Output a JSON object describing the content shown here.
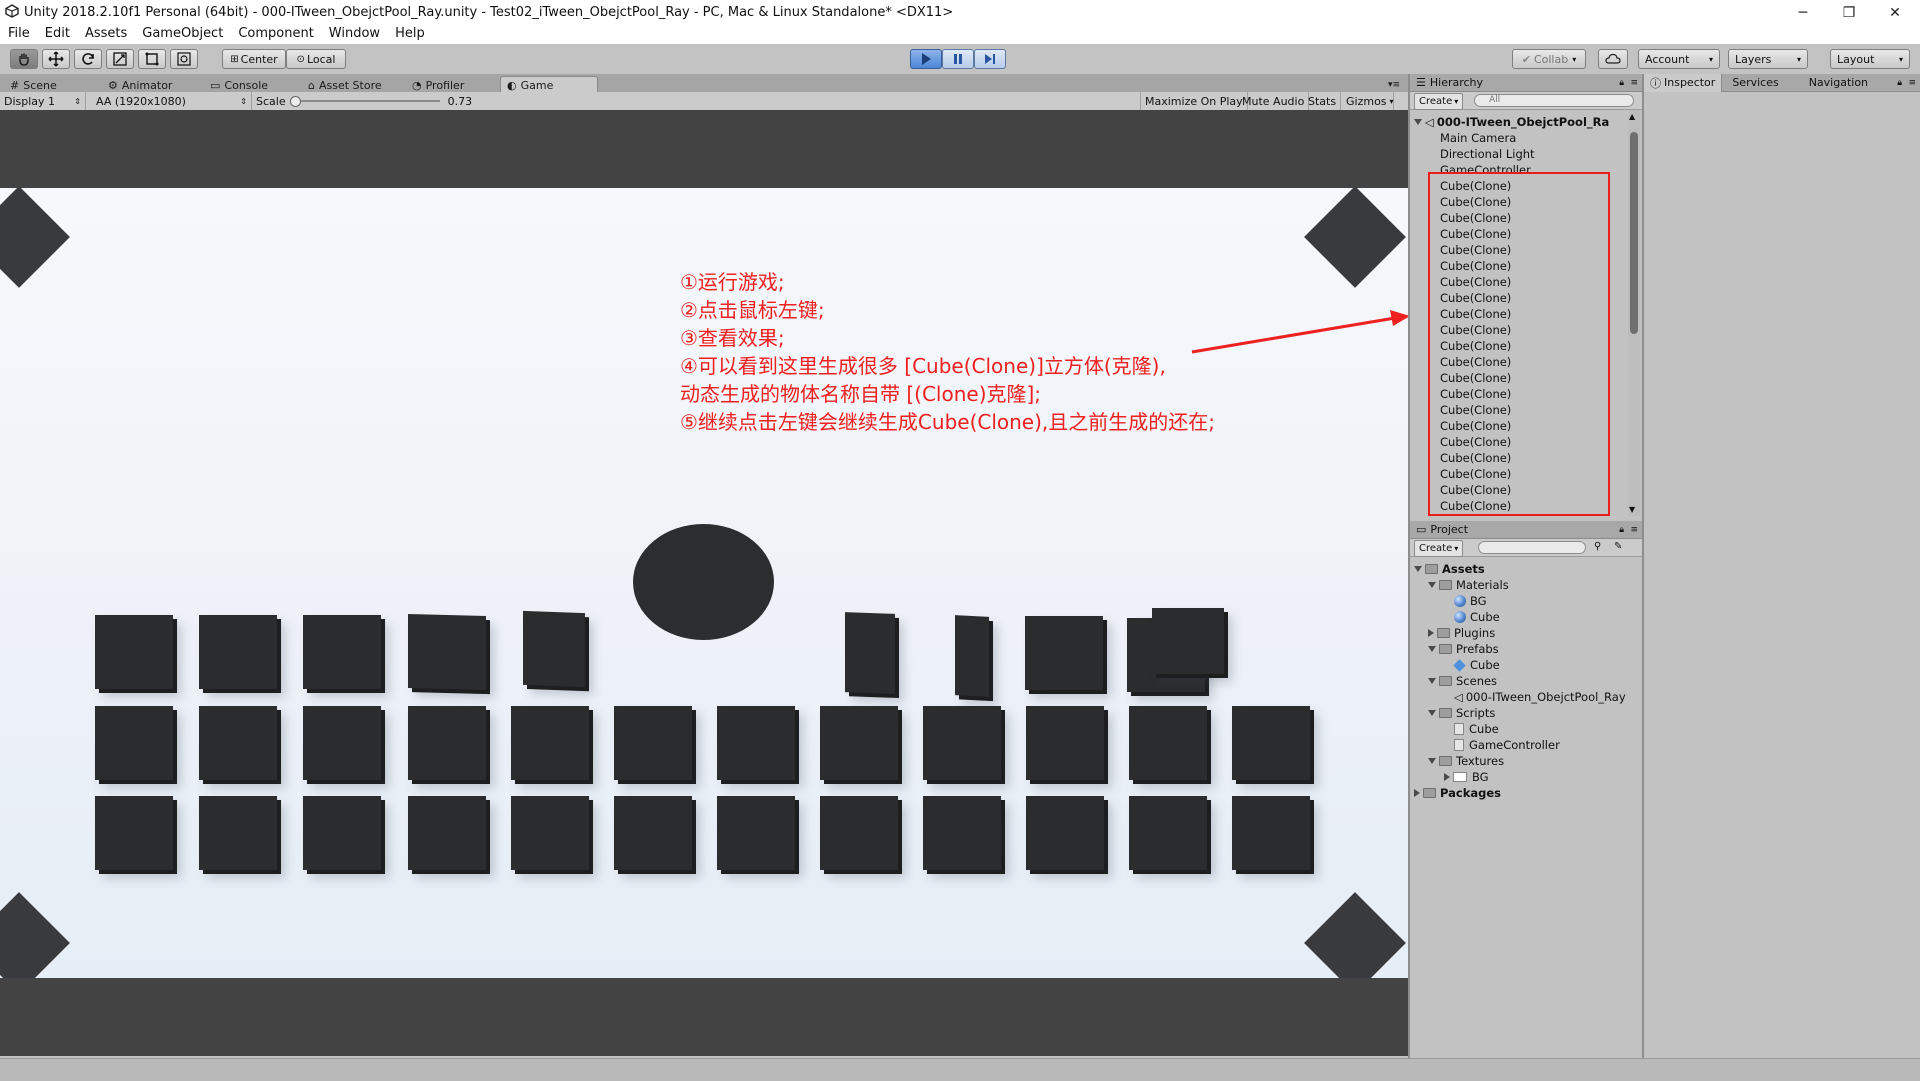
{
  "window": {
    "title": "Unity 2018.2.10f1 Personal (64bit) - 000-ITween_ObejctPool_Ray.unity - Test02_iTween_ObejctPool_Ray - PC, Mac & Linux Standalone* <DX11>",
    "minimize": "─",
    "restore": "❐",
    "close": "✕"
  },
  "menu": [
    "File",
    "Edit",
    "Assets",
    "GameObject",
    "Component",
    "Window",
    "Help"
  ],
  "toolbar": {
    "pivot_center": "Center",
    "pivot_local": "Local",
    "collab": "Collab",
    "account": "Account",
    "layers": "Layers",
    "layout": "Layout"
  },
  "tabs": {
    "scene": "Scene",
    "animator": "Animator",
    "console": "Console",
    "asset_store": "Asset Store",
    "profiler": "Profiler",
    "game": "Game"
  },
  "gamebar": {
    "display": "Display 1",
    "aspect": "AA (1920x1080)",
    "scale_label": "Scale",
    "scale_value": "0.73",
    "maximize_on_play": "Maximize On Play",
    "mute_audio": "Mute Audio",
    "stats": "Stats",
    "gizmos": "Gizmos"
  },
  "annotations": [
    "①运行游戏;",
    "②点击鼠标左键;",
    "③查看效果;",
    "④可以看到这里生成很多 [Cube(Clone)]立方体(克隆),",
    "动态生成的物体名称自带 [(Clone)克隆];",
    "⑤继续点击左键会继续生成Cube(Clone),且之前生成的还在;"
  ],
  "colors": {
    "annotation": "#ee2020",
    "cube": "#2b2c2e",
    "game_bg": "#444343",
    "editor_bg": "#c2c2c2",
    "play_blue": "#4b86d8"
  },
  "hierarchy": {
    "tab": "Hierarchy",
    "create": "Create",
    "search_placeholder": "All",
    "scene_name": "000-ITween_ObejctPool_Ra",
    "items": [
      "Main Camera",
      "Directional Light",
      "GameController"
    ],
    "clones": [
      "Cube(Clone)",
      "Cube(Clone)",
      "Cube(Clone)",
      "Cube(Clone)",
      "Cube(Clone)",
      "Cube(Clone)",
      "Cube(Clone)",
      "Cube(Clone)",
      "Cube(Clone)",
      "Cube(Clone)",
      "Cube(Clone)",
      "Cube(Clone)",
      "Cube(Clone)",
      "Cube(Clone)",
      "Cube(Clone)",
      "Cube(Clone)",
      "Cube(Clone)",
      "Cube(Clone)",
      "Cube(Clone)",
      "Cube(Clone)",
      "Cube(Clone)"
    ]
  },
  "project": {
    "tab": "Project",
    "create": "Create",
    "tree": {
      "assets": "Assets",
      "materials": "Materials",
      "bg": "BG",
      "cube": "Cube",
      "plugins": "Plugins",
      "prefabs": "Prefabs",
      "prefab_cube": "Cube",
      "scenes": "Scenes",
      "scene_file": "000-ITween_ObejctPool_Ray",
      "scripts": "Scripts",
      "script_cube": "Cube",
      "script_gc": "GameController",
      "textures": "Textures",
      "tex_bg": "BG",
      "packages": "Packages"
    }
  },
  "inspector": {
    "tab_inspector": "Inspector",
    "tab_services": "Services",
    "tab_navigation": "Navigation"
  }
}
